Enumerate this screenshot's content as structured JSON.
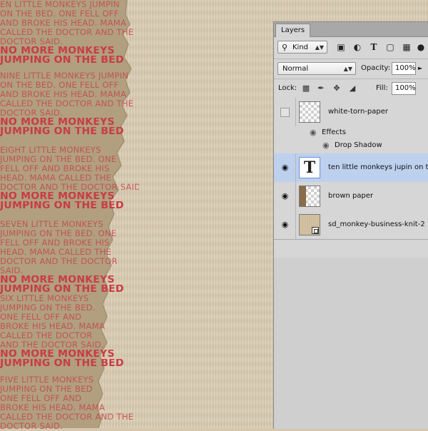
{
  "canvas": {
    "stanzas": [
      {
        "lines": [
          "en little monkeys jumpin",
          "on the bed. one fell off",
          "and broke his head. mama",
          "called the doctor and the",
          "doctor said."
        ],
        "emphasis": [
          "no more monkeys",
          "jumping on the bed"
        ]
      },
      {
        "lines": [
          "nine little monkeys jumpin",
          "on the bed. one fell off",
          "and broke his head. mama",
          "called the doctor and the",
          "doctor said."
        ],
        "emphasis": [
          "no more monkeys",
          "jumping on the bed"
        ]
      },
      {
        "lines": [
          "eight little monkeys",
          "jumping on the bed. one",
          "fell off and broke his",
          "head. mama called the",
          "doctor and the doctor said"
        ],
        "emphasis": [
          "no more monkeys",
          "jumping on the bed"
        ]
      },
      {
        "lines": [
          "seven little monkeys",
          "jumping on the bed. one",
          "fell off and broke his",
          "head. mama called the",
          "doctor and the doctor",
          "said."
        ],
        "emphasis": [
          "no more monkeys",
          "jumping on the bed"
        ]
      },
      {
        "lines": [
          "six little monkeys",
          "jumping on the bed.",
          "one fell off and",
          "broke his head. mama",
          "called the doctor",
          "and the doctor said."
        ],
        "emphasis": [
          "no more monkeys",
          "jumping on the bed"
        ]
      },
      {
        "lines": [
          "five little monkeys",
          "jumping on the bed",
          "one fell off and",
          "broke his head. mama",
          "called the doctor and the",
          "doctor said."
        ],
        "emphasis": []
      }
    ]
  },
  "panel": {
    "tab_label": "Layers",
    "filter": {
      "kind_label": "Kind",
      "icons": [
        "image-filter-icon",
        "adjustment-filter-icon",
        "type-filter-icon",
        "shape-filter-icon",
        "smart-object-filter-icon"
      ]
    },
    "blend_mode": "Normal",
    "opacity_label": "Opacity:",
    "opacity_value": "100%",
    "lock_label": "Lock:",
    "fill_label": "Fill:",
    "fill_value": "100%",
    "layers": [
      {
        "name": "white-torn-paper",
        "visible": false,
        "selected": false,
        "thumb": "transparent"
      },
      {
        "name": "ten little monkeys jupin on the bed",
        "visible": true,
        "selected": true,
        "thumb": "text"
      },
      {
        "name": "brown paper",
        "visible": true,
        "selected": false,
        "thumb": "brown"
      },
      {
        "name": "sd_monkey-business-knit-2",
        "visible": true,
        "selected": false,
        "thumb": "knit"
      }
    ],
    "effects": {
      "label": "Effects",
      "items": [
        "Drop Shadow"
      ]
    }
  }
}
